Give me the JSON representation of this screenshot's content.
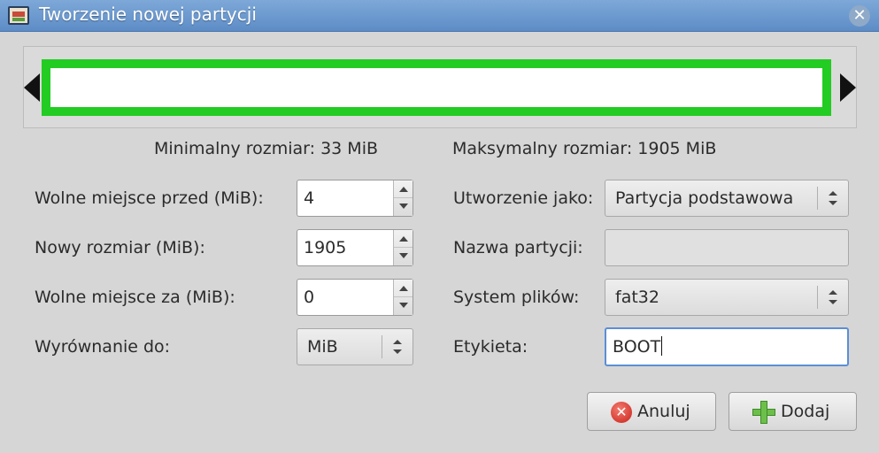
{
  "window": {
    "title": "Tworzenie nowej partycji",
    "close_icon": "close-icon"
  },
  "partition_preview": {
    "fill_color": "#22cc22"
  },
  "sizes": {
    "min_label": "Minimalny rozmiar: 33 MiB",
    "max_label": "Maksymalny rozmiar: 1905 MiB"
  },
  "left_form": {
    "free_before_label": "Wolne miejsce przed (MiB):",
    "free_before_value": "4",
    "new_size_label": "Nowy rozmiar (MiB):",
    "new_size_value": "1905",
    "free_after_label": "Wolne miejsce za (MiB):",
    "free_after_value": "0",
    "align_label": "Wyrównanie do:",
    "align_value": "MiB"
  },
  "right_form": {
    "create_as_label": "Utworzenie jako:",
    "create_as_value": "Partycja podstawowa",
    "name_label": "Nazwa partycji:",
    "name_value": "",
    "fs_label": "System plików:",
    "fs_value": "fat32",
    "label_label": "Etykieta:",
    "label_value": "BOOT"
  },
  "buttons": {
    "cancel_label": "Anuluj",
    "add_label": "Dodaj"
  }
}
